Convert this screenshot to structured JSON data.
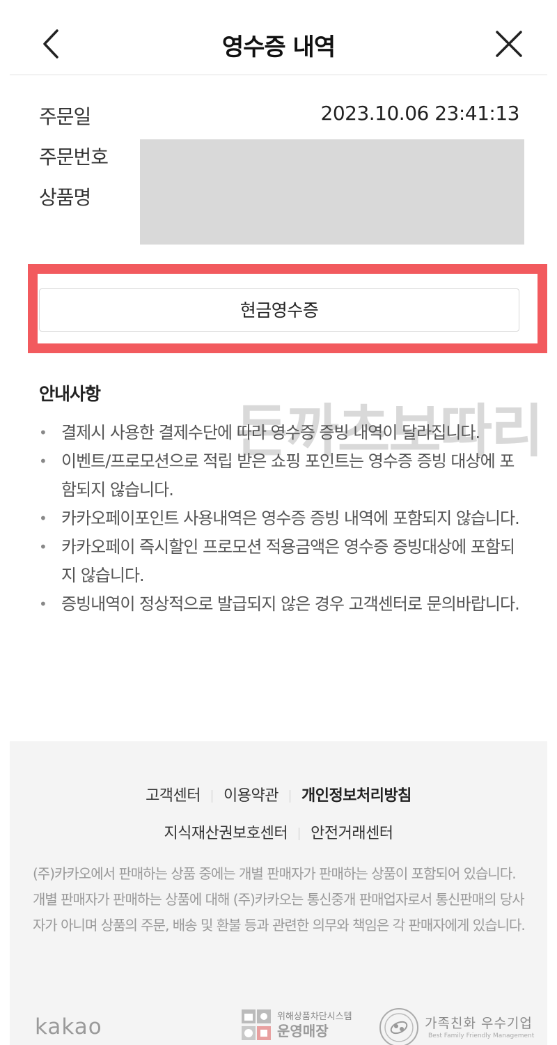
{
  "header": {
    "title": "영수증 내역",
    "back_icon": "chevron-left-icon",
    "close_icon": "close-icon"
  },
  "order": {
    "date_label": "주문일",
    "date_value": "2023.10.06 23:41:13",
    "number_label": "주문번호",
    "product_label": "상품명"
  },
  "receipt_button": {
    "label": "현금영수증",
    "highlight_color": "#f25a5e"
  },
  "notice": {
    "title": "안내사항",
    "watermark": "돈까츠보따리",
    "items": [
      "결제시 사용한 결제수단에 따라 영수증 증빙 내역이 달라집니다.",
      "이벤트/프로모션으로 적립 받은 쇼핑 포인트는 영수증 증빙 대상에 포함되지 않습니다.",
      "카카오페이포인트 사용내역은 영수증 증빙 내역에 포함되지 않습니다.",
      "카카오페이 즉시할인 프로모션 적용금액은 영수증 증빙대상에 포함되지 않습니다.",
      "증빙내역이 정상적으로 발급되지 않은 경우 고객센터로 문의바랍니다."
    ]
  },
  "footer": {
    "links_row1": [
      "고객센터",
      "이용약관",
      "개인정보처리방침"
    ],
    "links_row2": [
      "지식재산권보호센터",
      "안전거래센터"
    ],
    "disclaimer": "(주)카카오에서 판매하는 상품 중에는 개별 판매자가 판매하는 상품이 포함되어 있습니다. 개별 판매자가 판매하는 상품에 대해 (주)카카오는 통신중개 판매업자로서 통신판매의 당사자가 아니며 상품의 주문, 배송 및 환불 등과 관련한 의무와 책임은 각 판매자에게 있습니다.",
    "logo": "kakao",
    "badge1_top": "위해상품차단시스템",
    "badge1_bottom": "운영매장",
    "badge2_top": "가족친화 우수기업",
    "badge2_bottom": "Best Family Friendly Management"
  }
}
